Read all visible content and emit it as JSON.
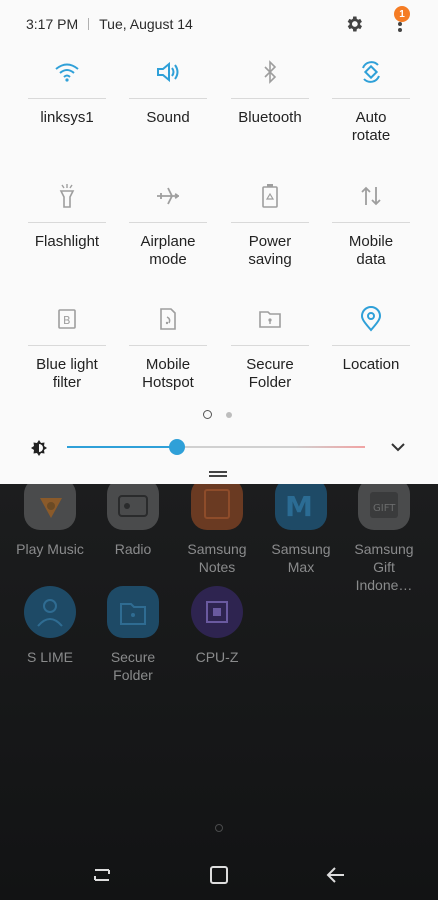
{
  "status": {
    "time": "3:17 PM",
    "date": "Tue, August 14",
    "notification_count": "1"
  },
  "icons": {
    "settings": "gear-icon",
    "more": "more-vert-icon"
  },
  "colors": {
    "accent": "#2fa0d8",
    "badge": "#f57c24",
    "panel_bg": "#fafafa"
  },
  "quick_settings": [
    {
      "label": "linksys1",
      "icon": "wifi-icon",
      "active": true
    },
    {
      "label": "Sound",
      "icon": "sound-icon",
      "active": true
    },
    {
      "label": "Bluetooth",
      "icon": "bluetooth-icon",
      "active": false
    },
    {
      "label": "Auto\nrotate",
      "icon": "auto-rotate-icon",
      "active": true
    },
    {
      "label": "Flashlight",
      "icon": "flashlight-icon",
      "active": false
    },
    {
      "label": "Airplane\nmode",
      "icon": "airplane-icon",
      "active": false
    },
    {
      "label": "Power\nsaving",
      "icon": "power-saving-icon",
      "active": false
    },
    {
      "label": "Mobile\ndata",
      "icon": "mobile-data-icon",
      "active": false
    },
    {
      "label": "Blue light\nfilter",
      "icon": "blue-light-filter-icon",
      "active": false
    },
    {
      "label": "Mobile\nHotspot",
      "icon": "mobile-hotspot-icon",
      "active": false
    },
    {
      "label": "Secure\nFolder",
      "icon": "secure-folder-icon",
      "active": false
    },
    {
      "label": "Location",
      "icon": "location-icon",
      "active": true
    }
  ],
  "pager": {
    "pages": 2,
    "current": 1
  },
  "brightness": {
    "level": 0.37
  },
  "home_apps": [
    {
      "label": "Play Music",
      "icon": "play-music-icon"
    },
    {
      "label": "Radio",
      "icon": "radio-icon"
    },
    {
      "label": "Samsung\nNotes",
      "icon": "samsung-notes-icon"
    },
    {
      "label": "Samsung\nMax",
      "icon": "samsung-max-icon"
    },
    {
      "label": "Samsung\nGift Indone…",
      "icon": "samsung-gift-icon"
    },
    {
      "label": "S LIME",
      "icon": "s-lime-icon"
    },
    {
      "label": "Secure\nFolder",
      "icon": "secure-folder-app-icon"
    },
    {
      "label": "CPU-Z",
      "icon": "cpu-z-icon"
    }
  ],
  "navbar": {
    "recents": "recents-icon",
    "home": "home-icon",
    "back": "back-icon"
  }
}
